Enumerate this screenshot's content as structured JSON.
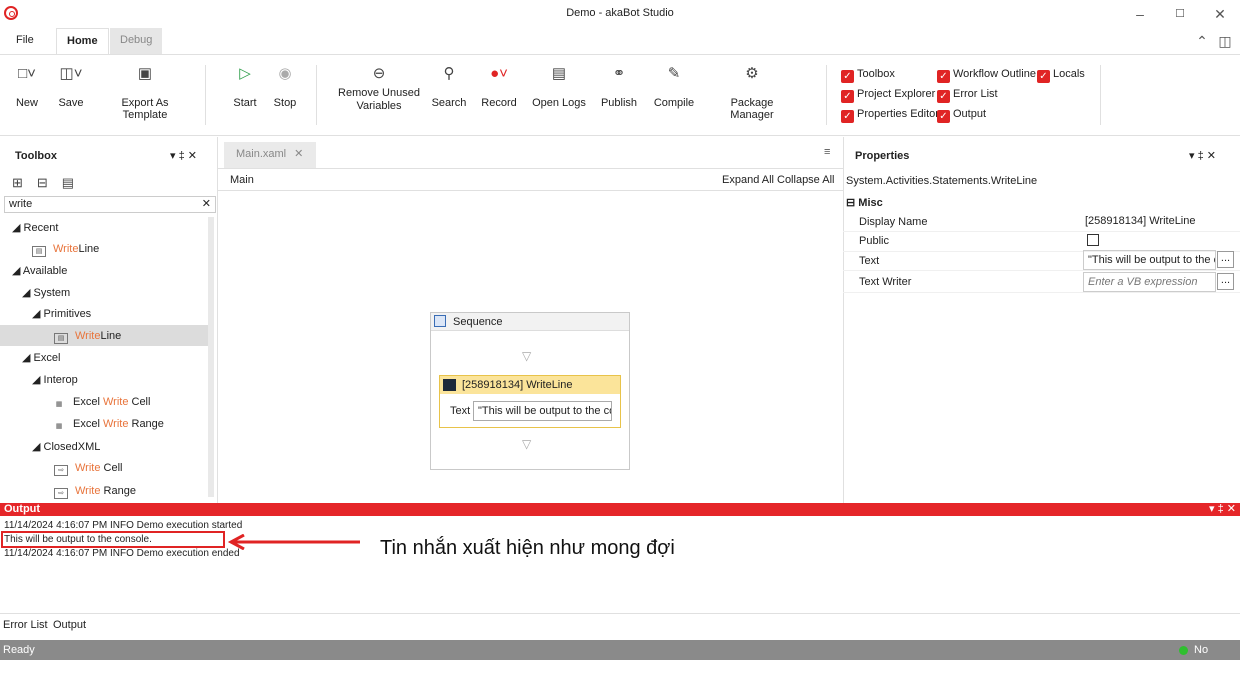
{
  "window": {
    "title": "Demo - akaBot Studio"
  },
  "tabs": {
    "file": "File",
    "home": "Home",
    "debug": "Debug"
  },
  "ribbon": {
    "new": "New",
    "save": "Save",
    "export_template": "Export As Template",
    "start": "Start",
    "stop": "Stop",
    "remove_unused_line1": "Remove Unused",
    "remove_unused_line2": "Variables",
    "search": "Search",
    "record": "Record",
    "open_logs": "Open Logs",
    "publish": "Publish",
    "compile": "Compile",
    "package_manager": "Package Manager",
    "checks": {
      "toolbox": "Toolbox",
      "workflow_outline": "Workflow Outline",
      "locals": "Locals",
      "project_explorer": "Project Explorer",
      "error_list": "Error List",
      "properties_editor": "Properties Editor",
      "output": "Output"
    }
  },
  "toolbox": {
    "title": "Toolbox",
    "search_value": "write",
    "items": {
      "recent": "Recent",
      "recent_writeline_hl": "Write",
      "recent_writeline_rest": "Line",
      "available": "Available",
      "system": "System",
      "primitives": "Primitives",
      "prim_writeline_hl": "Write",
      "prim_writeline_rest": "Line",
      "excel": "Excel",
      "interop": "Interop",
      "ewc_pre": "Excel ",
      "ewc_hl": "Write",
      "ewc_post": " Cell",
      "ewr_pre": "Excel ",
      "ewr_hl": "Write",
      "ewr_post": " Range",
      "closedxml": "ClosedXML",
      "wc_hl": "Write",
      "wc_post": " Cell",
      "wr_hl": "Write",
      "wr_post": " Range"
    }
  },
  "designer": {
    "tab": "Main.xaml",
    "breadcrumb": "Main",
    "expand_all": "Expand All",
    "collapse_all": "Collapse All",
    "sequence_label": "Sequence",
    "writeline_label": "[258918134] WriteLine",
    "text_label": "Text",
    "text_value": "\"This will be output to the co"
  },
  "properties": {
    "title": "Properties",
    "type": "System.Activities.Statements.WriteLine",
    "section": "Misc",
    "rows": {
      "display_name_label": "Display Name",
      "display_name_value": "[258918134] WriteLine",
      "public_label": "Public",
      "text_label": "Text",
      "text_value": "\"This will be output to the c",
      "text_writer_label": "Text Writer",
      "text_writer_placeholder": "Enter a VB expression"
    },
    "ellipsis": "..."
  },
  "output": {
    "title": "Output",
    "lines": [
      "11/14/2024 4:16:07 PM INFO Demo execution started",
      "This will be output to the console.",
      "11/14/2024 4:16:07 PM INFO Demo execution ended"
    ],
    "annotation": "Tin nhắn xuất hiện như mong đợi"
  },
  "bottom_tabs": {
    "error_list": "Error List",
    "output": "Output"
  },
  "status": {
    "left": "Ready",
    "right": "No Errors"
  },
  "colors": {
    "accent": "#e52629",
    "highlight": "#e8743b",
    "ok": "#2fbf2f"
  }
}
